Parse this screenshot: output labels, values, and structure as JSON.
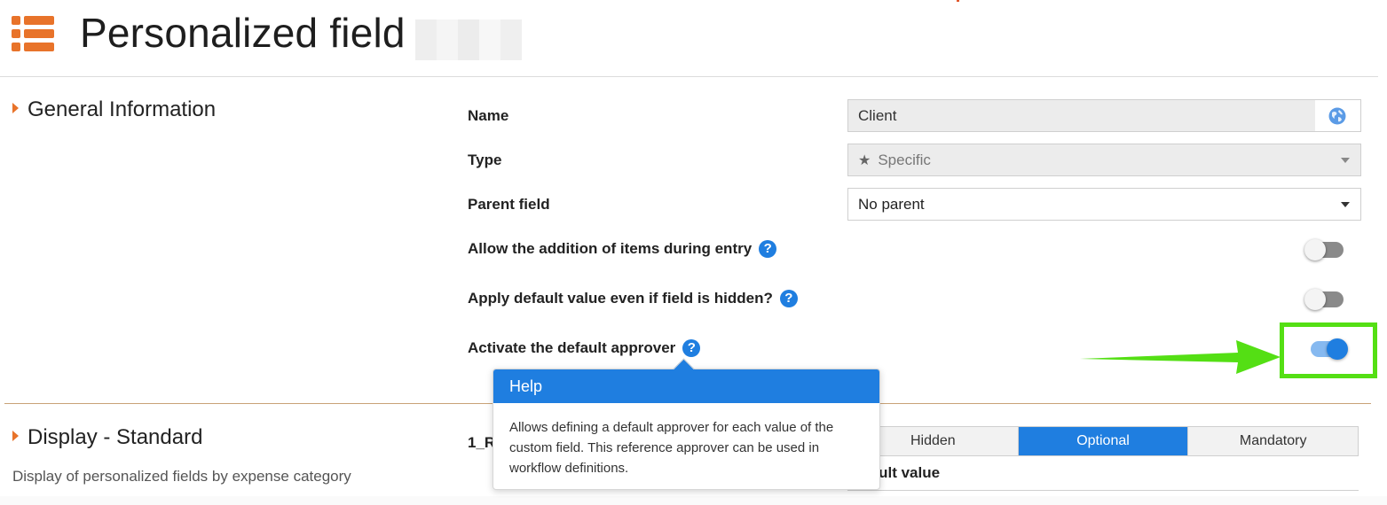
{
  "header": {
    "title": "Personalized field",
    "menu_icon": "hamburger-list-icon",
    "accent_color": "#e8732a"
  },
  "general_info": {
    "section_title": "General Information",
    "name": {
      "label": "Name",
      "value": "Client",
      "globe_icon": "globe-icon"
    },
    "type": {
      "label": "Type",
      "value": "Specific",
      "icon": "star-icon"
    },
    "parent_field": {
      "label": "Parent field",
      "value": "No parent"
    },
    "allow_addition": {
      "label": "Allow the addition of items during entry",
      "on": false
    },
    "apply_default": {
      "label": "Apply default value even if field is hidden?",
      "on": false
    },
    "default_approver": {
      "label": "Activate the default approver",
      "on": true
    }
  },
  "help_glyph": "?",
  "tooltip": {
    "title": "Help",
    "body": "Allows defining a default approver for each value of the custom field. This reference approver can be used in workflow definitions."
  },
  "display_standard": {
    "section_title": "Display - Standard",
    "subtitle": "Display of personalized fields by expense category",
    "row_label_partial": "1_R",
    "options": [
      "Hidden",
      "Optional",
      "Mandatory"
    ],
    "selected": "Optional",
    "default_value_label_partial": "fault value"
  },
  "colors": {
    "primary_blue": "#1f7ee0",
    "highlight_green": "#54df14"
  }
}
